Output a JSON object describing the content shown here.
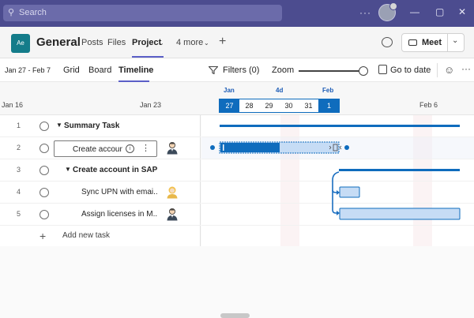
{
  "titlebar": {
    "search_placeholder": "Search",
    "more_label": "···",
    "window_controls": [
      "—",
      "▢",
      "✕"
    ],
    "icons": [
      "search-icon",
      "more-icon",
      "avatar",
      "minimize-icon",
      "maximize-icon",
      "close-icon"
    ]
  },
  "channel": {
    "team_initials": "Ae",
    "title": "General",
    "tabs": [
      {
        "label": "Posts",
        "active": false
      },
      {
        "label": "Files",
        "active": false
      },
      {
        "label": "Project",
        "active": true
      },
      {
        "label": "4 more",
        "active": false
      }
    ],
    "meet_label": "Meet",
    "accent": "#5b5fc7"
  },
  "toolbar": {
    "date_range": "Jan 27 - Feb 7",
    "views": [
      {
        "label": "Grid",
        "active": false
      },
      {
        "label": "Board",
        "active": false
      },
      {
        "label": "Timeline",
        "active": true
      }
    ],
    "filters_label": "Filters (0)",
    "zoom_label": "Zoom",
    "zoom_level": 0.93,
    "goto_label": "Go to date"
  },
  "timeline": {
    "dates_left": [
      "Jan 16",
      "Jan 23"
    ],
    "date_right": "Feb 6",
    "months": [
      "Jan",
      "4d",
      "Feb"
    ],
    "days": [
      {
        "label": "27",
        "selected": true
      },
      {
        "label": "28",
        "selected": false
      },
      {
        "label": "29",
        "selected": false
      },
      {
        "label": "30",
        "selected": false
      },
      {
        "label": "31",
        "selected": false
      },
      {
        "label": "1",
        "selected": true
      }
    ]
  },
  "tasks": [
    {
      "num": "1",
      "name": "Summary Task",
      "bold": true,
      "caret": true,
      "indent": 0
    },
    {
      "num": "2",
      "name": "Create account",
      "bold": false,
      "editing": true,
      "indent": 1
    },
    {
      "num": "3",
      "name": "Create account in SAP",
      "bold": true,
      "caret": true,
      "indent": 1
    },
    {
      "num": "4",
      "name": "Sync UPN with emai...",
      "bold": false,
      "indent": 2
    },
    {
      "num": "5",
      "name": "Assign licenses in M...",
      "bold": false,
      "indent": 2
    }
  ],
  "add_task_label": "Add new task",
  "colors": {
    "bar_blue": "#0f6cbd",
    "bar_light": "#c6dcf5",
    "title_bar": "#4c4c8f"
  }
}
